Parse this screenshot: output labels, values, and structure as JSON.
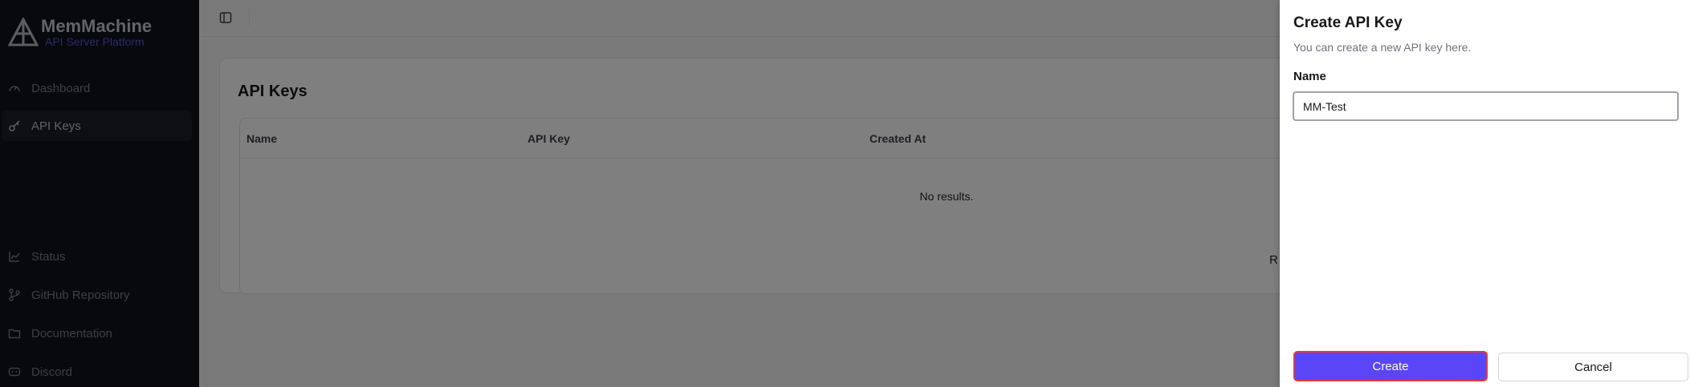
{
  "brand": {
    "name": "MemMachine",
    "subtitle": "API Server Platform"
  },
  "sidebar": {
    "items": [
      {
        "label": "Dashboard",
        "icon": "gauge-icon",
        "active": false
      },
      {
        "label": "API Keys",
        "icon": "key-icon",
        "active": true
      },
      {
        "label": "Status",
        "icon": "chart-line-icon",
        "active": false
      },
      {
        "label": "GitHub Repository",
        "icon": "git-branch-icon",
        "active": false
      },
      {
        "label": "Documentation",
        "icon": "folder-icon",
        "active": false
      },
      {
        "label": "Discord",
        "icon": "discord-icon",
        "active": false
      }
    ]
  },
  "main": {
    "title": "API Keys",
    "table": {
      "columns": [
        "Name",
        "API Key",
        "Created At"
      ],
      "empty_text": "No results."
    },
    "partial_text": "R"
  },
  "sheet": {
    "title": "Create API Key",
    "description": "You can create a new API key here.",
    "name_label": "Name",
    "name_value": "MM-Test",
    "create_label": "Create",
    "cancel_label": "Cancel"
  },
  "colors": {
    "accent": "#5a46f6",
    "sidebar_bg": "#101218",
    "brand_subtitle": "#5c52d9",
    "highlight_border": "#e53935"
  }
}
